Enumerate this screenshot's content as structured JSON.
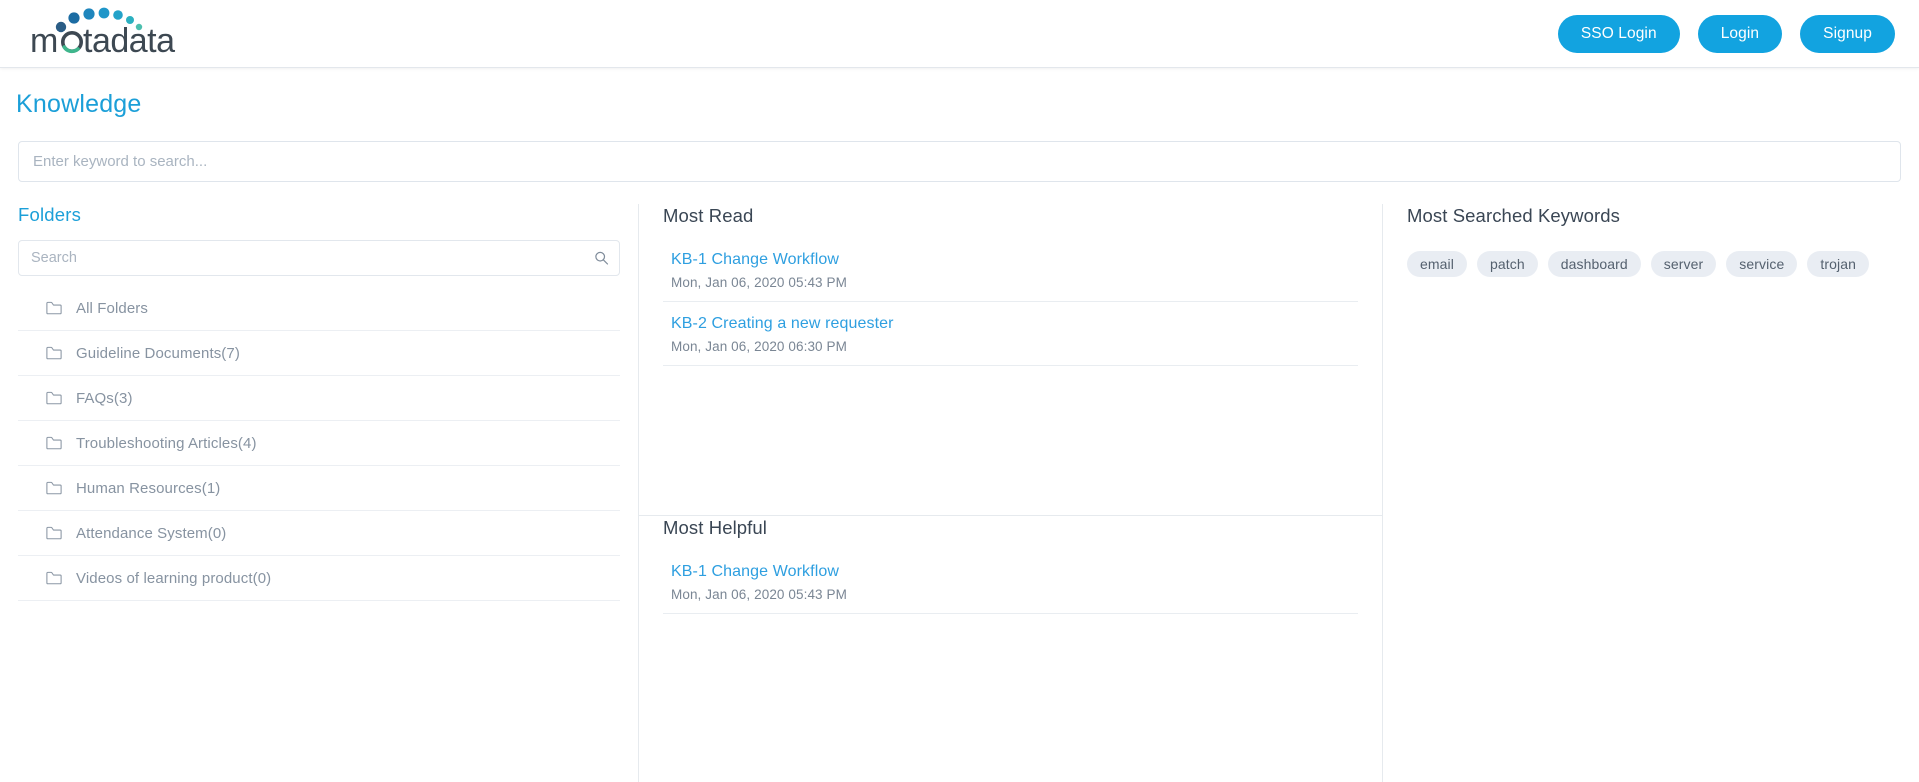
{
  "header": {
    "logo_text": "motadata",
    "logo_icon": "motadata-arc-logo",
    "buttons": [
      {
        "label": "SSO Login",
        "name": "sso-login-button"
      },
      {
        "label": "Login",
        "name": "login-button"
      },
      {
        "label": "Signup",
        "name": "signup-button"
      }
    ],
    "accent_color": "#12a3e0"
  },
  "page": {
    "title": "Knowledge",
    "title_color": "#1b9fd8"
  },
  "search": {
    "placeholder": "Enter keyword to search...",
    "value": ""
  },
  "folders": {
    "heading": "Folders",
    "search_placeholder": "Search",
    "search_value": "",
    "search_icon": "search-icon",
    "items": [
      {
        "label": "All Folders",
        "icon": "folder-icon"
      },
      {
        "label": "Guideline Documents(7)",
        "icon": "folder-icon"
      },
      {
        "label": "FAQs(3)",
        "icon": "folder-icon"
      },
      {
        "label": "Troubleshooting Articles(4)",
        "icon": "folder-icon"
      },
      {
        "label": "Human Resources(1)",
        "icon": "folder-icon"
      },
      {
        "label": "Attendance System(0)",
        "icon": "folder-icon"
      },
      {
        "label": "Videos of learning product(0)",
        "icon": "folder-icon"
      }
    ]
  },
  "most_read": {
    "heading": "Most Read",
    "articles": [
      {
        "title": "KB-1 Change Workflow",
        "date": "Mon, Jan 06, 2020 05:43 PM"
      },
      {
        "title": "KB-2 Creating a new requester",
        "date": "Mon, Jan 06, 2020 06:30 PM"
      }
    ]
  },
  "most_helpful": {
    "heading": "Most Helpful",
    "articles": [
      {
        "title": "KB-1 Change Workflow",
        "date": "Mon, Jan 06, 2020 05:43 PM"
      }
    ]
  },
  "most_searched_keywords": {
    "heading": "Most Searched Keywords",
    "tags": [
      "email",
      "patch",
      "dashboard",
      "server",
      "service",
      "trojan"
    ],
    "tag_background": "#e9edf3",
    "tag_text_color": "#55616f"
  }
}
